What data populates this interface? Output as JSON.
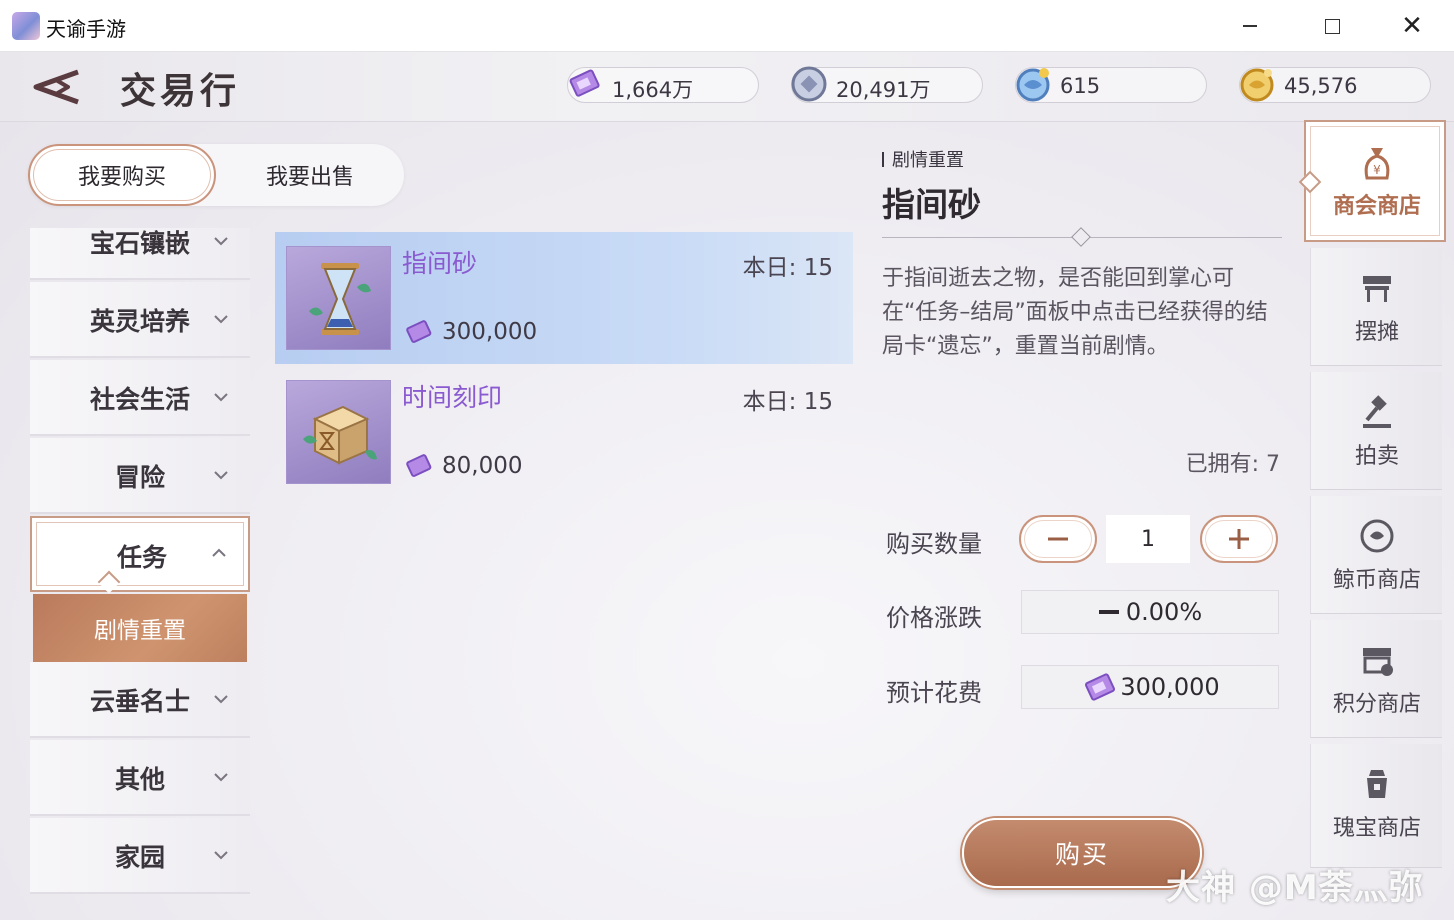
{
  "window": {
    "title": "天谕手游",
    "close_glyph": "✕"
  },
  "header": {
    "title": "交易行",
    "currencies": [
      {
        "icon": "purple-ticket-icon",
        "value": "1,664万"
      },
      {
        "icon": "silver-coin-icon",
        "value": "20,491万"
      },
      {
        "icon": "blue-whale-coin-icon",
        "value": "615"
      },
      {
        "icon": "gold-coin-icon",
        "value": "45,576"
      }
    ]
  },
  "mode": {
    "buy": "我要购买",
    "sell": "我要出售",
    "selected": "buy"
  },
  "categories": {
    "items": [
      "宝石镶嵌",
      "英灵培养",
      "社会生活",
      "冒险",
      "任务",
      "云垂名士",
      "其他",
      "家园"
    ],
    "active": "任务",
    "active_sub": "剧情重置"
  },
  "items": [
    {
      "name": "指间砂",
      "daily_limit": "本日: 15",
      "price": "300,000",
      "selected": true
    },
    {
      "name": "时间刻印",
      "daily_limit": "本日: 15",
      "price": "80,000",
      "selected": false
    }
  ],
  "detail": {
    "category": "剧情重置",
    "title": "指间砂",
    "description": "于指间逝去之物，是否能回到掌心可在“任务–结局”面板中点击已经获得的结局卡“遗忘”，重置当前剧情。",
    "owned": "已拥有: 7",
    "quantity_label": "购买数量",
    "quantity": "1",
    "price_change_label": "价格涨跌",
    "price_change": "0.00%",
    "cost_label": "预计花费",
    "cost": "300,000",
    "buy_label": "购买"
  },
  "shop_tabs": [
    {
      "label": "商会商店",
      "icon": "money-bag-icon",
      "active": true
    },
    {
      "label": "摆摊",
      "icon": "stall-icon",
      "active": false
    },
    {
      "label": "拍卖",
      "icon": "gavel-icon",
      "active": false
    },
    {
      "label": "鲸币商店",
      "icon": "whale-coin-icon",
      "active": false
    },
    {
      "label": "积分商店",
      "icon": "points-shop-icon",
      "active": false
    },
    {
      "label": "瑰宝商店",
      "icon": "treasure-icon",
      "active": false
    }
  ],
  "watermark": "大神 @M荼灬弥",
  "colors": {
    "accent": "#c89b87",
    "selected_row": "#c3d6f4",
    "item_name": "#8a5bd0",
    "sub_active": "#c48b6e"
  }
}
